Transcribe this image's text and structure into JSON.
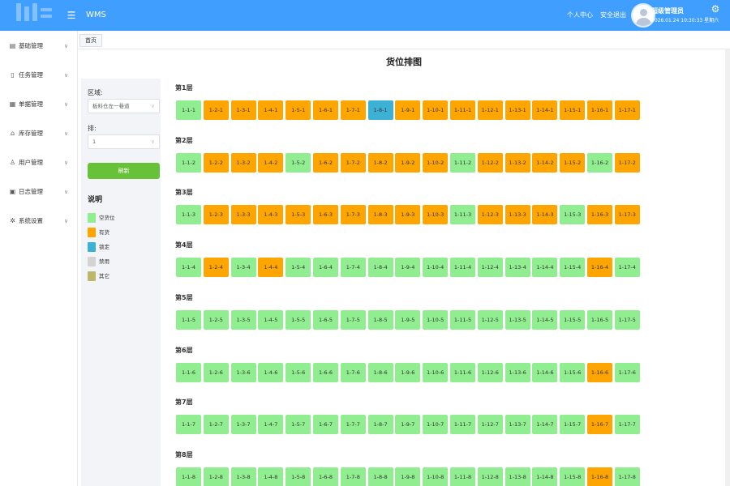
{
  "header": {
    "app_title": "WMS",
    "personal_center": "个人中心",
    "logout": "安全退出",
    "user_name": "超级管理员",
    "datetime": "2026.01.24 10:30:33 星期六"
  },
  "sidebar": {
    "items": [
      {
        "label": "基础管理",
        "icon": "doc-icon"
      },
      {
        "label": "任务管理",
        "icon": "clipboard-icon"
      },
      {
        "label": "单据管理",
        "icon": "form-icon"
      },
      {
        "label": "库存管理",
        "icon": "warehouse-icon"
      },
      {
        "label": "用户管理",
        "icon": "user-icon"
      },
      {
        "label": "日志管理",
        "icon": "calendar-icon"
      },
      {
        "label": "系统设置",
        "icon": "settings-icon"
      }
    ]
  },
  "tabs": {
    "home": "首页"
  },
  "page": {
    "title": "货位排图"
  },
  "filter": {
    "area_label": "区域:",
    "area_value": "板料仓左一巷道",
    "row_label": "排:",
    "row_value": "1",
    "refresh": "刷新"
  },
  "legend": {
    "title": "说明",
    "items": [
      {
        "label": "空货位",
        "color": "#90ee90"
      },
      {
        "label": "有货",
        "color": "#ffa500"
      },
      {
        "label": "锁定",
        "color": "#3db0d6"
      },
      {
        "label": "禁用",
        "color": "#d3d3d3"
      },
      {
        "label": "其它",
        "color": "#bdb76b"
      }
    ]
  },
  "status_colors": {
    "empty": "#90ee90",
    "occupied": "#ffa500",
    "locked": "#3db0d6",
    "disabled": "#d3d3d3",
    "other": "#bdb76b"
  },
  "tiers": [
    {
      "label": "第1层",
      "cells": [
        "1-1-1",
        "1-2-1",
        "1-3-1",
        "1-4-1",
        "1-5-1",
        "1-6-1",
        "1-7-1",
        "1-8-1",
        "1-9-1",
        "1-10-1",
        "1-11-1",
        "1-12-1",
        "1-13-1",
        "1-14-1",
        "1-15-1",
        "1-16-1",
        "1-17-1"
      ],
      "status": [
        "empty",
        "occupied",
        "occupied",
        "occupied",
        "occupied",
        "occupied",
        "occupied",
        "locked",
        "occupied",
        "occupied",
        "occupied",
        "occupied",
        "occupied",
        "occupied",
        "occupied",
        "occupied",
        "occupied"
      ]
    },
    {
      "label": "第2层",
      "cells": [
        "1-1-2",
        "1-2-2",
        "1-3-2",
        "1-4-2",
        "1-5-2",
        "1-6-2",
        "1-7-2",
        "1-8-2",
        "1-9-2",
        "1-10-2",
        "1-11-2",
        "1-12-2",
        "1-13-2",
        "1-14-2",
        "1-15-2",
        "1-16-2",
        "1-17-2"
      ],
      "status": [
        "empty",
        "occupied",
        "occupied",
        "occupied",
        "empty",
        "occupied",
        "occupied",
        "occupied",
        "occupied",
        "occupied",
        "empty",
        "occupied",
        "occupied",
        "occupied",
        "occupied",
        "empty",
        "occupied"
      ]
    },
    {
      "label": "第3层",
      "cells": [
        "1-1-3",
        "1-2-3",
        "1-3-3",
        "1-4-3",
        "1-5-3",
        "1-6-3",
        "1-7-3",
        "1-8-3",
        "1-9-3",
        "1-10-3",
        "1-11-3",
        "1-12-3",
        "1-13-3",
        "1-14-3",
        "1-15-3",
        "1-16-3",
        "1-17-3"
      ],
      "status": [
        "empty",
        "occupied",
        "occupied",
        "occupied",
        "occupied",
        "occupied",
        "occupied",
        "occupied",
        "occupied",
        "occupied",
        "empty",
        "occupied",
        "occupied",
        "occupied",
        "empty",
        "occupied",
        "occupied"
      ]
    },
    {
      "label": "第4层",
      "cells": [
        "1-1-4",
        "1-2-4",
        "1-3-4",
        "1-4-4",
        "1-5-4",
        "1-6-4",
        "1-7-4",
        "1-8-4",
        "1-9-4",
        "1-10-4",
        "1-11-4",
        "1-12-4",
        "1-13-4",
        "1-14-4",
        "1-15-4",
        "1-16-4",
        "1-17-4"
      ],
      "status": [
        "empty",
        "occupied",
        "empty",
        "occupied",
        "empty",
        "empty",
        "empty",
        "empty",
        "empty",
        "empty",
        "empty",
        "empty",
        "empty",
        "empty",
        "empty",
        "occupied",
        "empty"
      ]
    },
    {
      "label": "第5层",
      "cells": [
        "1-1-5",
        "1-2-5",
        "1-3-5",
        "1-4-5",
        "1-5-5",
        "1-6-5",
        "1-7-5",
        "1-8-5",
        "1-9-5",
        "1-10-5",
        "1-11-5",
        "1-12-5",
        "1-13-5",
        "1-14-5",
        "1-15-5",
        "1-16-5",
        "1-17-5"
      ],
      "status": [
        "empty",
        "empty",
        "empty",
        "empty",
        "empty",
        "empty",
        "empty",
        "empty",
        "empty",
        "empty",
        "empty",
        "empty",
        "empty",
        "empty",
        "empty",
        "empty",
        "empty"
      ]
    },
    {
      "label": "第6层",
      "cells": [
        "1-1-6",
        "1-2-6",
        "1-3-6",
        "1-4-6",
        "1-5-6",
        "1-6-6",
        "1-7-6",
        "1-8-6",
        "1-9-6",
        "1-10-6",
        "1-11-6",
        "1-12-6",
        "1-13-6",
        "1-14-6",
        "1-15-6",
        "1-16-6",
        "1-17-6"
      ],
      "status": [
        "empty",
        "empty",
        "empty",
        "empty",
        "empty",
        "empty",
        "empty",
        "empty",
        "empty",
        "empty",
        "empty",
        "empty",
        "empty",
        "empty",
        "empty",
        "occupied",
        "empty"
      ]
    },
    {
      "label": "第7层",
      "cells": [
        "1-1-7",
        "1-2-7",
        "1-3-7",
        "1-4-7",
        "1-5-7",
        "1-6-7",
        "1-7-7",
        "1-8-7",
        "1-9-7",
        "1-10-7",
        "1-11-7",
        "1-12-7",
        "1-13-7",
        "1-14-7",
        "1-15-7",
        "1-16-7",
        "1-17-7"
      ],
      "status": [
        "empty",
        "empty",
        "empty",
        "empty",
        "empty",
        "empty",
        "empty",
        "empty",
        "empty",
        "empty",
        "empty",
        "empty",
        "empty",
        "empty",
        "empty",
        "occupied",
        "empty"
      ]
    },
    {
      "label": "第8层",
      "cells": [
        "1-1-8",
        "1-2-8",
        "1-3-8",
        "1-4-8",
        "1-5-8",
        "1-6-8",
        "1-7-8",
        "1-8-8",
        "1-9-8",
        "1-10-8",
        "1-11-8",
        "1-12-8",
        "1-13-8",
        "1-14-8",
        "1-15-8",
        "1-16-8",
        "1-17-8"
      ],
      "status": [
        "empty",
        "empty",
        "empty",
        "empty",
        "empty",
        "empty",
        "empty",
        "empty",
        "empty",
        "empty",
        "empty",
        "empty",
        "empty",
        "empty",
        "empty",
        "occupied",
        "empty"
      ]
    }
  ]
}
